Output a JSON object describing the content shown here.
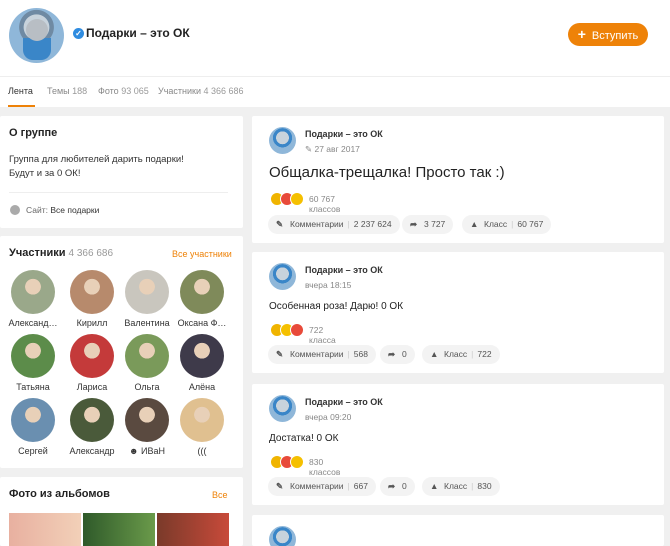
{
  "group": {
    "title": "Подарки – это ОК",
    "join_label": "Вступить"
  },
  "tabs": [
    {
      "label": "Лента",
      "count": ""
    },
    {
      "label": "Темы",
      "count": "188"
    },
    {
      "label": "Фото",
      "count": "93 065"
    },
    {
      "label": "Участники",
      "count": "4 366 686"
    }
  ],
  "about": {
    "title": "О группе",
    "text_line1": "Группа для любителей дарить подарки!",
    "text_line2": "Будут и за 0 ОК!",
    "site_label": "Сайт:",
    "site_value": "Все подарки"
  },
  "members": {
    "title": "Участники",
    "count": "4 366 686",
    "all_link": "Все участники",
    "list": [
      {
        "name": "Александ…",
        "color": "#9aa88a"
      },
      {
        "name": "Кирилл",
        "color": "#b78a6c"
      },
      {
        "name": "Валентина",
        "color": "#c9c6be"
      },
      {
        "name": "Оксана Ф…",
        "color": "#7f8a5a"
      },
      {
        "name": "Татьяна",
        "color": "#5c8c4a"
      },
      {
        "name": "Лариса",
        "color": "#c43a3a"
      },
      {
        "name": "Ольга",
        "color": "#7a9a5a"
      },
      {
        "name": "Алёна",
        "color": "#3e3a4a"
      },
      {
        "name": "Сергей",
        "color": "#6a8fb0"
      },
      {
        "name": "Александр",
        "color": "#4a5a3a"
      },
      {
        "name": "☻ ИВаН",
        "color": "#5a4a40"
      },
      {
        "name": "(((",
        "color": "#e0c090"
      }
    ]
  },
  "albums": {
    "title": "Фото из альбомов",
    "all_link": "Все"
  },
  "posts": [
    {
      "author": "Подарки – это ОК",
      "date": "27 авг 2017",
      "text": "Общалка-трещалка! Просто так :)",
      "reactions": "60 767 классов",
      "comments_label": "Комментарии",
      "comments": "2 237 624",
      "shares": "3 727",
      "likes_label": "Класс",
      "likes": "60 767"
    },
    {
      "author": "Подарки – это ОК",
      "date": "вчера 18:15",
      "text": "Особенная роза! Дарю! 0 ОК",
      "reactions": "722 класса",
      "comments_label": "Комментарии",
      "comments": "568",
      "shares": "0",
      "likes_label": "Класс",
      "likes": "722"
    },
    {
      "author": "Подарки – это ОК",
      "date": "вчера 09:20",
      "text": "Достатка! 0 ОК",
      "reactions": "830 классов",
      "comments_label": "Комментарии",
      "comments": "667",
      "shares": "0",
      "likes_label": "Класс",
      "likes": "830"
    }
  ]
}
